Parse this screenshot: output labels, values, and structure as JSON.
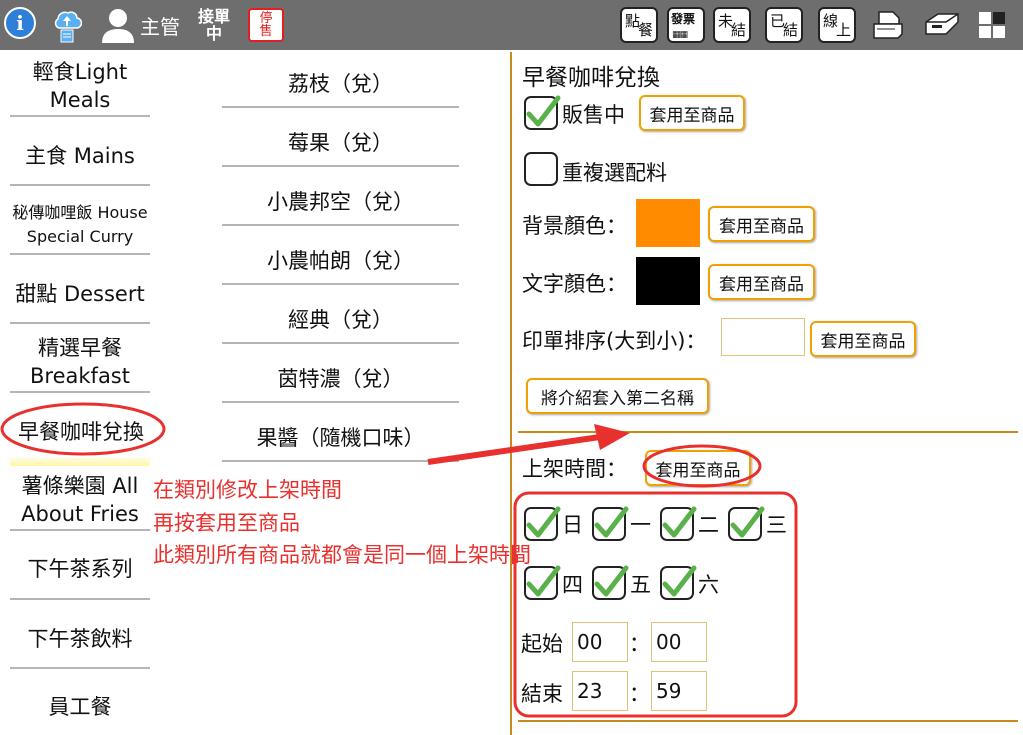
{
  "topbar": {
    "info_icon": "i",
    "cloud_icon": "cloud-upload-icon",
    "user_icon": "user-icon",
    "user_label": "主管",
    "status_line1": "接單",
    "status_line2": "中",
    "stop_line1": "停",
    "stop_line2": "售",
    "buttons": [
      {
        "a": "點",
        "b": "餐"
      },
      {
        "a": "發票",
        "b": "▦▦"
      },
      {
        "a": "未",
        "b": "結"
      },
      {
        "a": "已",
        "b": "結"
      },
      {
        "a": "線",
        "b": "上"
      }
    ]
  },
  "categories": [
    {
      "line1": "輕食Light",
      "line2": "Meals"
    },
    {
      "line1": "主食 Mains"
    },
    {
      "line1": "秘傳咖哩飯 House",
      "line2": "Special Curry"
    },
    {
      "line1": "甜點 Dessert"
    },
    {
      "line1": "精選早餐",
      "line2": "Breakfast"
    },
    {
      "line1": "早餐咖啡兌換"
    },
    {
      "line1": "薯條樂園 All",
      "line2": "About Fries"
    },
    {
      "line1": "下午茶系列"
    },
    {
      "line1": "下午茶飲料"
    },
    {
      "line1": "員工餐"
    }
  ],
  "products": [
    "荔枝（兌）",
    "莓果（兌）",
    "小農邦空（兌）",
    "小農帕朗（兌）",
    "經典（兌）",
    "茵特濃（兌）",
    "果醬（隨機口味）"
  ],
  "panel": {
    "title": "早餐咖啡兌換",
    "on_sale_label": "販售中",
    "on_sale_checked": true,
    "apply_label": "套用至商品",
    "repeat_label": "重複選配料",
    "repeat_checked": false,
    "bg_color_label": "背景顏色：",
    "bg_color": "#ff8c00",
    "text_color_label": "文字顏色：",
    "text_color": "#000000",
    "print_order_label": "印單排序(大到小)：",
    "print_order_value": "",
    "intro_btn_label": "將介紹套入第二名稱",
    "shelf_time_label": "上架時間：",
    "days": [
      {
        "label": "日",
        "checked": true
      },
      {
        "label": "一",
        "checked": true
      },
      {
        "label": "二",
        "checked": true
      },
      {
        "label": "三",
        "checked": true
      },
      {
        "label": "四",
        "checked": true
      },
      {
        "label": "五",
        "checked": true
      },
      {
        "label": "六",
        "checked": true
      }
    ],
    "start_label": "起始",
    "start_hour": "00",
    "start_min": "00",
    "end_label": "結束",
    "end_hour": "23",
    "end_min": "59",
    "colon": "："
  },
  "annotation": {
    "line1": "在類別修改上架時間",
    "line2": "再按套用至商品",
    "line3": "此類別所有商品就都會是同一個上架時間",
    "color": "#e8312e"
  }
}
